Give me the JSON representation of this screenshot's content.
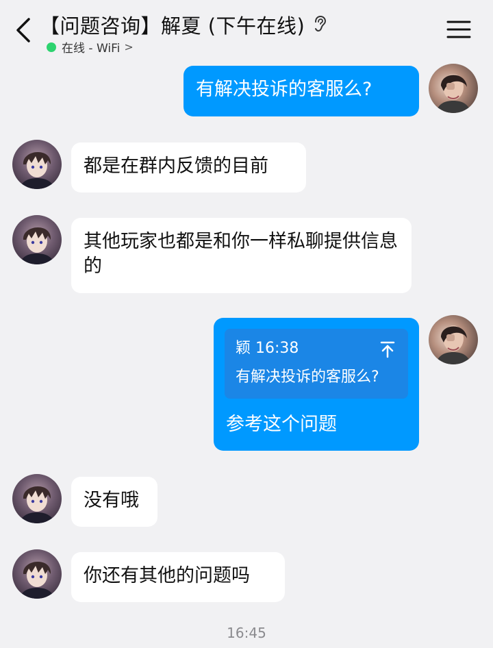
{
  "header": {
    "back_icon": "chevron-left-icon",
    "title": "【问题咨询】解夏 (下午在线)",
    "listen_icon": "ear-icon",
    "status_text": "在线 - WiFi",
    "status_color": "#2dd36f",
    "status_chevron": ">",
    "menu_icon": "hamburger-menu-icon"
  },
  "messages": [
    {
      "side": "out",
      "text": "有解决投诉的客服么?"
    },
    {
      "side": "in",
      "text": "都是在群内反馈的目前"
    },
    {
      "side": "in",
      "text": "其他玩家也都是和你一样私聊提供信息的"
    },
    {
      "side": "out",
      "quote": {
        "author": "颖",
        "time": "16:38",
        "text": "有解决投诉的客服么?"
      },
      "text": "参考这个问题"
    },
    {
      "side": "in",
      "text": "没有哦"
    },
    {
      "side": "in",
      "text": "你还有其他的问题吗"
    }
  ],
  "timestamp": "16:45",
  "colors": {
    "background": "#f1f1f3",
    "outgoing_bubble": "#0099ff",
    "incoming_bubble": "#ffffff",
    "quote_box": "#1b86e6"
  }
}
